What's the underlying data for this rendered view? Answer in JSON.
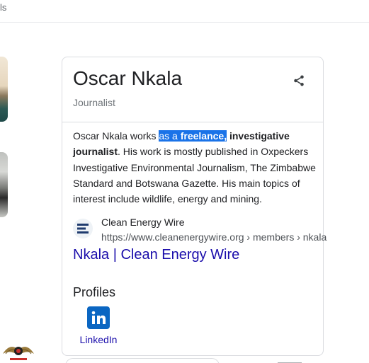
{
  "top_strip": {
    "tab_fragment": "ls"
  },
  "panel": {
    "title": "Oscar Nkala",
    "subtitle": "Journalist",
    "share_icon": "share-icon",
    "description": {
      "part1": "Oscar Nkala works ",
      "highlight_plain": "as a ",
      "highlight_bold": "freelance,",
      "space": " ",
      "bold": "investigative journalist",
      "part2": ". His work is mostly published in Oxpeckers Investigative Environmental Journalism, The Zimbabwe Standard and Botswana Gazette. His main topics of interest include wildlife, energy and mining."
    },
    "source": {
      "name": "Clean Energy Wire",
      "url": "https://www.cleanenergywire.org › members › nkala",
      "favicon": "clean-energy-wire-icon"
    },
    "result_link": "Nkala | Clean Energy Wire",
    "profiles": {
      "heading": "Profiles",
      "items": [
        {
          "label": "LinkedIn",
          "icon": "linkedin-icon"
        }
      ]
    }
  },
  "colors": {
    "link": "#1a0dab",
    "highlight": "#1a73e8",
    "linkedin": "#0a66c2",
    "border": "#dadce0",
    "muted": "#70757a"
  }
}
